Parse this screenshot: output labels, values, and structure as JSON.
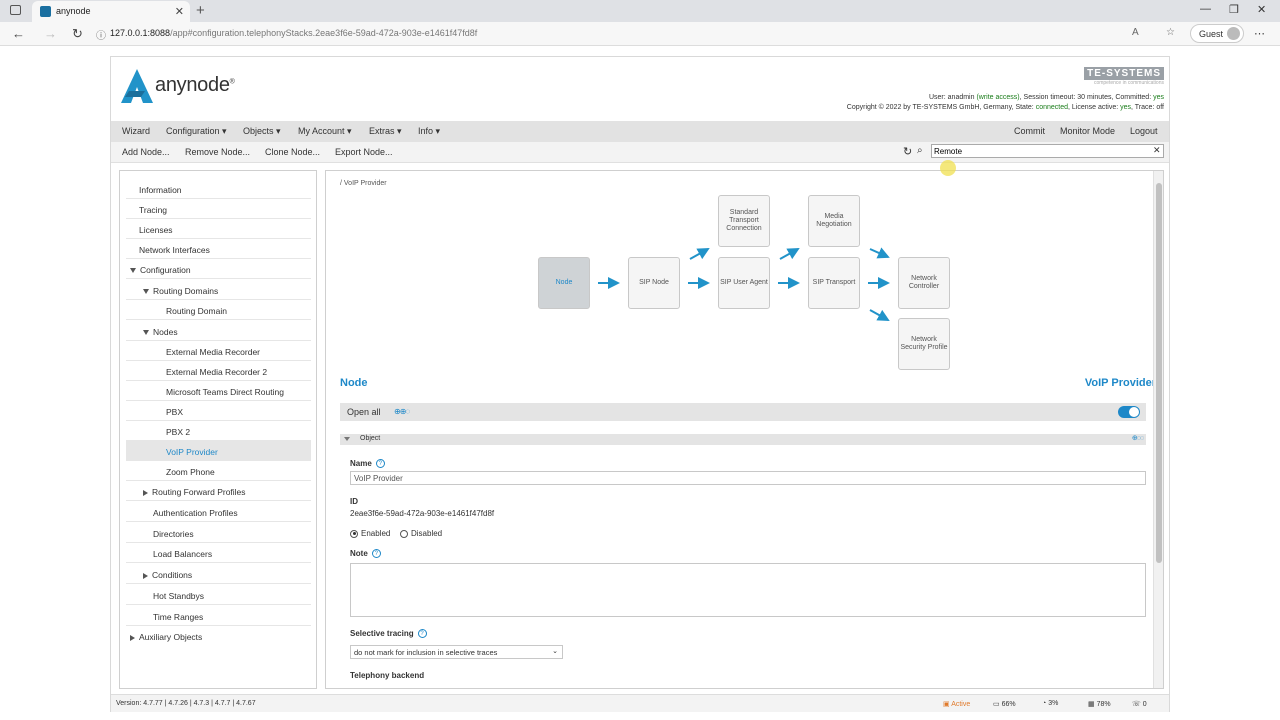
{
  "browser": {
    "tab_title": "anynode",
    "url_host": "127.0.0.1:8088",
    "url_path": "/app#configuration.telephonyStacks.2eae3f6e-59ad-472a-903e-e1461f47fd8f",
    "profile_label": "Guest"
  },
  "header": {
    "logo_text": "anynode",
    "logo_reg": "®",
    "vendor_logo": "TE-SYSTEMS",
    "vendor_tagline": "competence in communications",
    "line1_prefix": "User: anadmin ",
    "line1_ok": "(write access)",
    "line1_suffix": ", Session timeout: 30 minutes, Committed: ",
    "line1_committed": "yes",
    "line2": "Copyright © 2022 by TE-SYSTEMS GmbH, Germany, State: ",
    "line2_state": "connected",
    "line2_mid": ", License active: ",
    "line2_license": "yes",
    "line2_suffix": ", Trace: off"
  },
  "menubar": {
    "wizard": "Wizard",
    "configuration": "Configuration",
    "objects": "Objects",
    "my_account": "My Account",
    "extras": "Extras",
    "info": "Info",
    "commit": "Commit",
    "monitor_mode": "Monitor Mode",
    "logout": "Logout"
  },
  "toolbar": {
    "add_node": "Add Node...",
    "remove_node": "Remove Node...",
    "clone_node": "Clone Node...",
    "export_node": "Export Node...",
    "search_value": "Remote"
  },
  "sidebar": {
    "information": "Information",
    "tracing": "Tracing",
    "licenses": "Licenses",
    "network_interfaces": "Network Interfaces",
    "configuration": "Configuration",
    "routing_domains": "Routing Domains",
    "routing_domain": "Routing Domain",
    "nodes": "Nodes",
    "node1": "External Media Recorder",
    "node2": "External Media Recorder 2",
    "node3": "Microsoft Teams Direct Routing",
    "node4": "PBX",
    "node5": "PBX 2",
    "node6": "VoIP Provider",
    "node7": "Zoom Phone",
    "routing_forward_profiles": "Routing Forward Profiles",
    "authentication_profiles": "Authentication Profiles",
    "directories": "Directories",
    "load_balancers": "Load Balancers",
    "conditions": "Conditions",
    "hot_standbys": "Hot Standbys",
    "time_ranges": "Time Ranges",
    "auxiliary_objects": "Auxiliary Objects"
  },
  "content": {
    "breadcrumb": "/ VoIP Provider",
    "diagram": {
      "node": "Node",
      "sip_node": "SIP Node",
      "std_transport": "Standard Transport Connection",
      "sip_user_agent": "SIP User Agent",
      "media_negotiation": "Media Negotiation",
      "sip_transport": "SIP Transport",
      "network_controller": "Network Controller",
      "network_security_profile": "Network Security Profile"
    },
    "section_left": "Node",
    "section_right": "VoIP Provider",
    "open_all": "Open all",
    "object_label": "Object",
    "name_label": "Name",
    "name_value": "VoIP Provider",
    "id_label": "ID",
    "id_value": "2eae3f6e-59ad-472a-903e-e1461f47fd8f",
    "enabled_label": "Enabled",
    "disabled_label": "Disabled",
    "note_label": "Note",
    "selective_tracing_label": "Selective tracing",
    "selective_tracing_value": "do not mark for inclusion in selective traces",
    "telephony_backend_label": "Telephony backend"
  },
  "status": {
    "version": "Version: 4.7.77 | 4.7.26 | 4.7.3 | 4.7.7 | 4.7.67",
    "active": "Active",
    "disk": "66%",
    "cpu": "3%",
    "memory": "78%",
    "calls": "0"
  },
  "colors": {
    "accent": "#1e88c8",
    "ok_green": "#1a7c1a",
    "active_orange": "#e07a2b"
  }
}
